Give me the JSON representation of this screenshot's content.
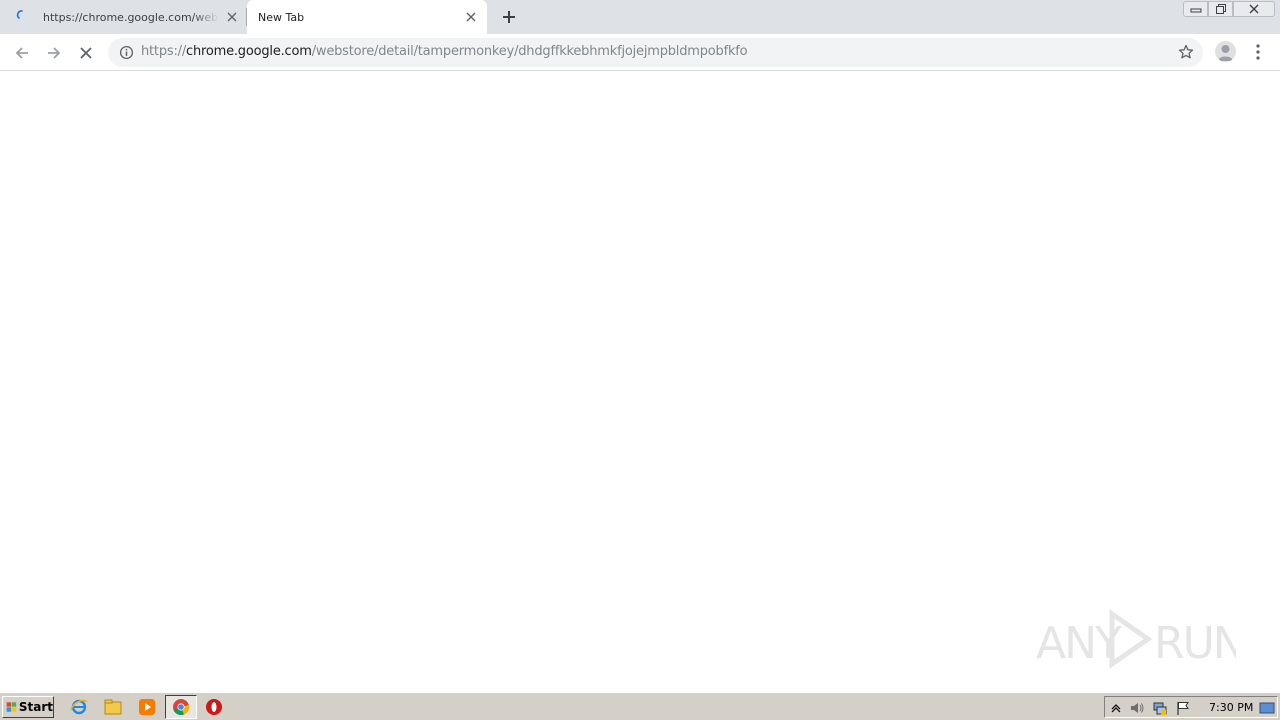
{
  "browser": {
    "tabs": [
      {
        "title": "https://chrome.google.com/webstore/detail/tampermonkey/dhdgffkkebhmkfjojejmpbldmpobfkfo",
        "loading": true,
        "active": false
      },
      {
        "title": "New Tab",
        "loading": false,
        "active": true
      }
    ],
    "new_tab_symbol": "+",
    "address": {
      "scheme": "https://",
      "host": "chrome.google.com",
      "path": "/webstore/detail/tampermonkey/dhdgffkkebhmkfjojejmpbldmpobfkfo"
    },
    "colors": {
      "tabstrip": "#dee1e6",
      "omnibox": "#f1f3f4",
      "spinner": "#1a73e8"
    }
  },
  "watermark": {
    "text": "ANY RUN"
  },
  "taskbar": {
    "start_label": "Start",
    "clock": "7:30 PM",
    "pinned": [
      "internet-explorer-icon",
      "file-explorer-icon",
      "media-player-icon",
      "chrome-icon",
      "opera-icon"
    ],
    "tray": [
      "show-hidden-icons-icon",
      "volume-icon",
      "network-icon",
      "action-center-flag-icon",
      "show-desktop-icon"
    ]
  }
}
